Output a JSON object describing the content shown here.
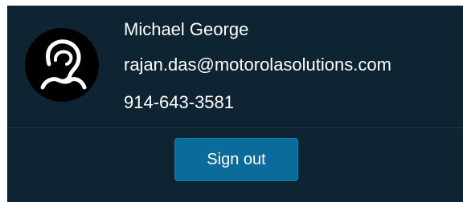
{
  "user": {
    "name": "Michael George",
    "email": "rajan.das@motorolasolutions.com",
    "phone": "914-643-3581",
    "avatar_icon": "user-profile-icon"
  },
  "actions": {
    "sign_out_label": "Sign out"
  },
  "colors": {
    "panel_background": "#0e2433",
    "button_background": "#0b6b9a",
    "text": "#ffffff",
    "avatar_background": "#000000"
  }
}
